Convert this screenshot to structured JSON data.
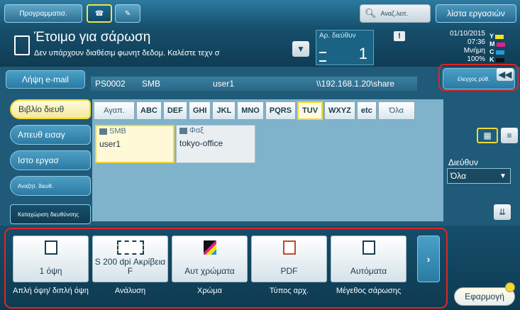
{
  "topbar": {
    "program_label": "Προγραμματισ.",
    "search_label": "Αναζ.λειτ.",
    "joblist_label": "λίστα εργασιών"
  },
  "status": {
    "title": "Έτοιμο για σάρωση",
    "subtitle": "Δεν υπάρχουν διαθέσιμ φωνητ δεδομ. Καλέστε τεχν σ",
    "addr_count_label": "Αρ. διεύθυν",
    "addr_count": "1",
    "date": "01/10/2015",
    "time": "07:36",
    "memory_label": "Μνήμη",
    "memory_value": "100%",
    "toner": [
      "Y",
      "M",
      "C",
      "K"
    ],
    "toner_colors": [
      "#f3e21b",
      "#e0218a",
      "#1f9ed6",
      "#111111"
    ]
  },
  "info": {
    "email_button": "Λήψη e-mail",
    "id": "PS0002",
    "type": "SMB",
    "user": "user1",
    "path": "\\\\192.168.1.20\\share",
    "check_button": "έλεγχος ρύθ."
  },
  "sidebar": {
    "items": [
      "Βιβλίο διευθ",
      "Απευθ εισαγ",
      "Ιστο εργασ",
      "Αναζητ. διευθ.",
      "Καταχώριση διευθύνσης"
    ]
  },
  "filters": {
    "items": [
      "Αγαπ.",
      "ABC",
      "DEF",
      "GHI",
      "JKL",
      "MNO",
      "PQRS",
      "TUV",
      "WXYZ",
      "etc",
      "Όλα"
    ],
    "selected": "TUV"
  },
  "entries": [
    {
      "type": "SMB",
      "name": "user1"
    },
    {
      "type": "Φαξ",
      "name": "tokyo-office"
    }
  ],
  "right": {
    "addr_label": "Διεύθυν",
    "addr_value": "Όλα"
  },
  "functions": [
    {
      "value": "1 όψη",
      "label": "Απλή όψη/ διπλή όψη"
    },
    {
      "value": "S 200 dpi Ακρίβεια F",
      "label": "Ανάλυση"
    },
    {
      "value": "Αυτ χρώματα",
      "label": "Χρώμα"
    },
    {
      "value": "PDF",
      "label": "Τύπος αρχ."
    },
    {
      "value": "Αυτόματα",
      "label": "Μέγεθος σάρωσης"
    }
  ],
  "apply_label": "Εφαρμογή"
}
